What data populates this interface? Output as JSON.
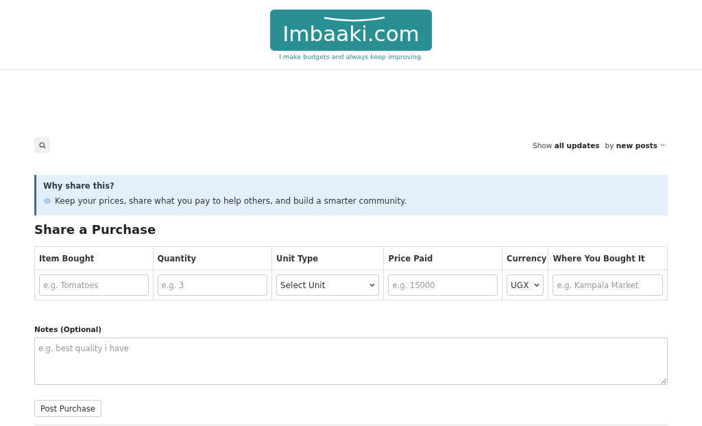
{
  "logo": {
    "text": "Imbaaki.com",
    "tagline": "I make budgets and always keep improving."
  },
  "filter": {
    "show": "Show **all updates**",
    "sort": "by **new posts**"
  },
  "info": {
    "title": "Why share this?",
    "text": "Keep your prices, share what you pay to help others, and build a smarter community."
  },
  "heading": "Share a Purchase",
  "table": {
    "columns": [
      {
        "label": "Item Bought",
        "kind": "input",
        "placeholder": "e.g. Tomatoes"
      },
      {
        "label": "Quantity",
        "kind": "input",
        "placeholder": "e.g. 3"
      },
      {
        "label": "Unit Type",
        "kind": "select",
        "value": "Select Unit"
      },
      {
        "label": "Price Paid",
        "kind": "input",
        "placeholder": "e.g. 15000"
      },
      {
        "label": "Currency",
        "kind": "select",
        "value": "UGX"
      },
      {
        "label": "Where You Bought It",
        "kind": "input",
        "placeholder": "e.g. Kampala Market"
      }
    ]
  },
  "notes": {
    "label": "Notes (Optional)",
    "placeholder": "e.g. best quality i have"
  },
  "submit": "Post Purchase"
}
